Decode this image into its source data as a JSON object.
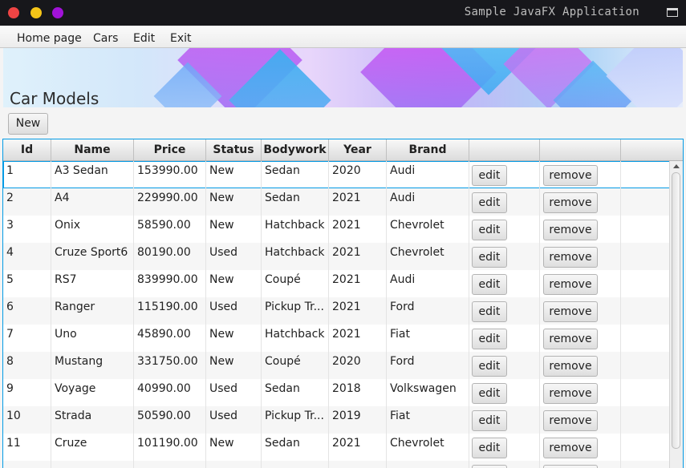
{
  "window": {
    "title": "Sample JavaFX Application"
  },
  "menu": [
    "Home page",
    "Cars",
    "Edit",
    "Exit"
  ],
  "banner": {
    "title": "Car Models"
  },
  "toolbar": {
    "new_label": "New"
  },
  "table": {
    "columns": [
      "Id",
      "Name",
      "Price",
      "Status",
      "Bodywork",
      "Year",
      "Brand",
      "",
      ""
    ],
    "edit_label": "edit",
    "remove_label": "remove",
    "rows": [
      [
        "1",
        "A3 Sedan",
        "153990.00",
        "New",
        "Sedan",
        "2020",
        "Audi"
      ],
      [
        "2",
        "A4",
        "229990.00",
        "New",
        "Sedan",
        "2021",
        "Audi"
      ],
      [
        "3",
        "Onix",
        "58590.00",
        "New",
        "Hatchback",
        "2021",
        "Chevrolet"
      ],
      [
        "4",
        "Cruze Sport6",
        "80190.00",
        "Used",
        "Hatchback",
        "2021",
        "Chevrolet"
      ],
      [
        "5",
        "RS7",
        "839990.00",
        "New",
        "Coupé",
        "2021",
        "Audi"
      ],
      [
        "6",
        "Ranger",
        "115190.00",
        "Used",
        "Pickup Tr...",
        "2021",
        "Ford"
      ],
      [
        "7",
        "Uno",
        "45890.00",
        "New",
        "Hatchback",
        "2021",
        "Fiat"
      ],
      [
        "8",
        "Mustang",
        "331750.00",
        "New",
        "Coupé",
        "2020",
        "Ford"
      ],
      [
        "9",
        "Voyage",
        "40990.00",
        "Used",
        "Sedan",
        "2018",
        "Volkswagen"
      ],
      [
        "10",
        "Strada",
        "50590.00",
        "Used",
        "Pickup Tr...",
        "2019",
        "Fiat"
      ],
      [
        "11",
        "Cruze",
        "101190.00",
        "New",
        "Sedan",
        "2021",
        "Chevrolet"
      ]
    ],
    "selected_row": 0
  },
  "colors": {
    "accent": "#039be5",
    "titlebar": "#17171b"
  }
}
